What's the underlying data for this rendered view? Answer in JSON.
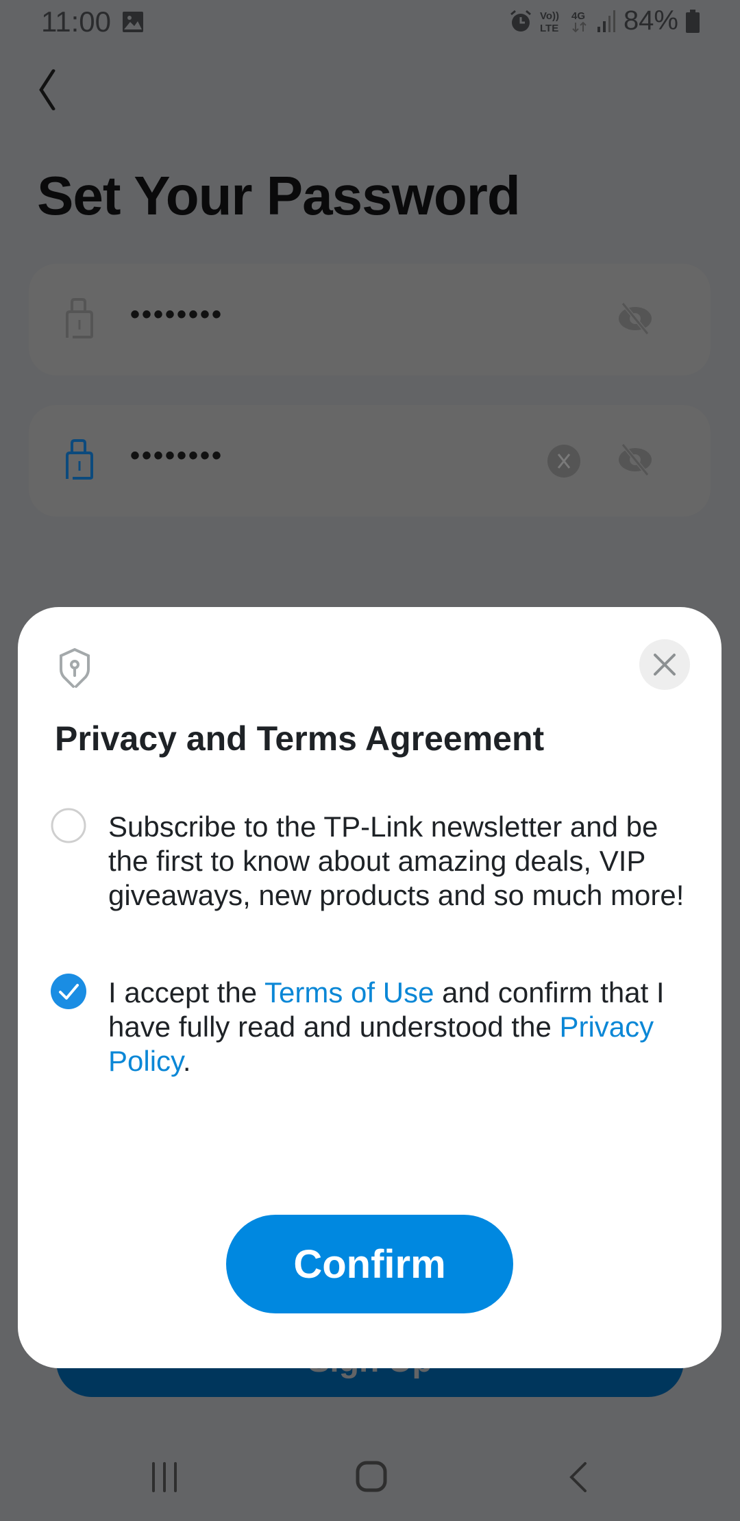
{
  "status_bar": {
    "time": "11:00",
    "battery": "84%",
    "network": "4G",
    "volte": "VoLTE",
    "icons": [
      "gallery-icon",
      "alarm-icon",
      "volte-icon",
      "4g-icon",
      "signal-icon",
      "battery-icon"
    ]
  },
  "page": {
    "title": "Set Your Password",
    "password_field": {
      "value": "••••••••",
      "icon": "lock-icon",
      "visibility_icon": "eye-off-icon"
    },
    "confirm_password_field": {
      "value": "••••••••",
      "icon": "lock-icon",
      "clear_icon": "clear-icon",
      "visibility_icon": "eye-off-icon"
    },
    "signup_label": "Sign Up"
  },
  "modal": {
    "title": "Privacy and Terms Agreement",
    "options": [
      {
        "checked": false,
        "text": "Subscribe to the TP-Link newsletter and be the first to know about amazing deals, VIP giveaways, new products and so much more!"
      },
      {
        "checked": true,
        "text_before": "I accept the ",
        "link1": "Terms of Use",
        "text_middle": " and confirm that I have fully read and understood the ",
        "link2": "Privacy Policy",
        "text_after": "."
      }
    ],
    "confirm_label": "Confirm",
    "colors": {
      "accent": "#0088e0",
      "link": "#0b87d6"
    }
  },
  "nav_bar": {
    "buttons": [
      "recent-apps",
      "home",
      "back"
    ]
  }
}
